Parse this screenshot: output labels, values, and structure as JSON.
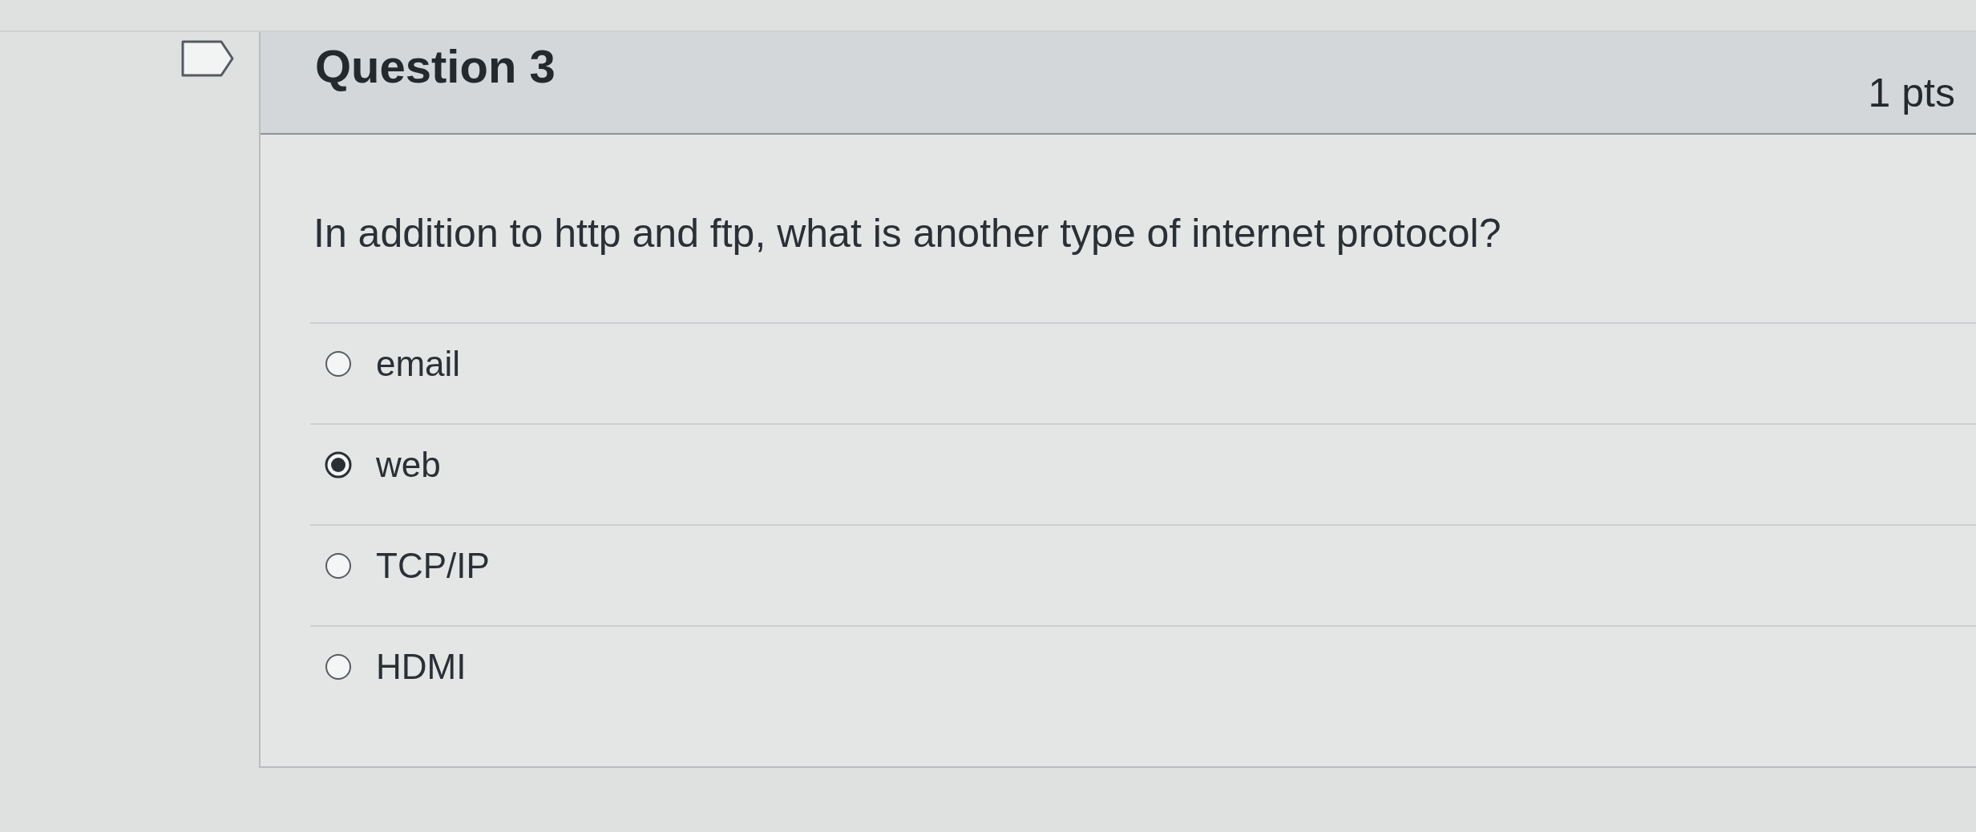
{
  "question": {
    "flagged": false,
    "title": "Question 3",
    "points": "1 pts",
    "text": "In addition to http and ftp, what is another type of internet protocol?",
    "answers": [
      {
        "label": "email",
        "selected": false
      },
      {
        "label": "web",
        "selected": true
      },
      {
        "label": "TCP/IP",
        "selected": false
      },
      {
        "label": "HDMI",
        "selected": false
      }
    ]
  }
}
